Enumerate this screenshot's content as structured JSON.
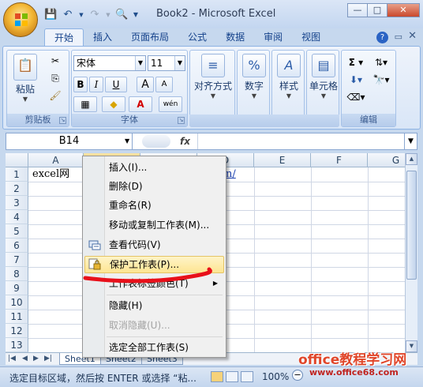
{
  "window": {
    "title": "Book2 - Microsoft Excel",
    "qat_icons": [
      "save-icon",
      "undo-icon",
      "redo-icon",
      "print-preview-icon",
      "customize-qat-icon"
    ]
  },
  "ribbon": {
    "tabs": [
      "开始",
      "插入",
      "页面布局",
      "公式",
      "数据",
      "审阅",
      "视图"
    ],
    "active_tab": "开始",
    "groups": {
      "clipboard": {
        "label": "剪贴板",
        "paste_label": "粘贴"
      },
      "font": {
        "label": "字体",
        "font_name": "宋体",
        "font_size": "11",
        "bold": "B",
        "italic": "I",
        "underline": "U",
        "grow": "A",
        "shrink": "A",
        "phonetic": "wén"
      },
      "alignment": {
        "label": "对齐方式"
      },
      "number": {
        "label": "数字",
        "symbol": "%"
      },
      "styles": {
        "label": "样式"
      },
      "cells": {
        "label": "单元格"
      },
      "editing": {
        "label": "编辑",
        "sum": "Σ"
      }
    }
  },
  "formula_bar": {
    "name_box": "B14",
    "fx": "fx",
    "formula": ""
  },
  "grid": {
    "columns": [
      "A",
      "B",
      "C",
      "D",
      "E",
      "F",
      "G"
    ],
    "rows": [
      "1",
      "2",
      "3",
      "4",
      "5",
      "6",
      "7",
      "8",
      "9",
      "10",
      "11",
      "12",
      "13"
    ],
    "cells": {
      "A1": "excel网",
      "D1": "n/"
    }
  },
  "sheet_tabs": [
    "Sheet1",
    "Sheet2",
    "Sheet3"
  ],
  "status_bar": {
    "message": "选定目标区域，然后按 ENTER 或选择 “粘...",
    "zoom": "100%"
  },
  "context_menu": {
    "items": [
      {
        "label": "插入(I)...",
        "enabled": true
      },
      {
        "label": "删除(D)",
        "enabled": true
      },
      {
        "label": "重命名(R)",
        "enabled": true
      },
      {
        "label": "移动或复制工作表(M)...",
        "enabled": true
      },
      {
        "label": "查看代码(V)",
        "enabled": true,
        "icon": "view-code-icon"
      },
      {
        "label": "保护工作表(P)...",
        "enabled": true,
        "highlighted": true,
        "icon": "protect-sheet-icon"
      },
      {
        "label": "工作表标签颜色(T)",
        "enabled": true,
        "submenu": true
      },
      {
        "label": "隐藏(H)",
        "enabled": true
      },
      {
        "label": "取消隐藏(U)...",
        "enabled": false
      },
      {
        "label": "选定全部工作表(S)",
        "enabled": true
      }
    ]
  },
  "watermark": {
    "line1": "office教程学习网",
    "line2": "www.office68.com"
  },
  "colors": {
    "accent": "#15428b",
    "highlight": "#fde592",
    "annotation_red": "#e8101a"
  }
}
